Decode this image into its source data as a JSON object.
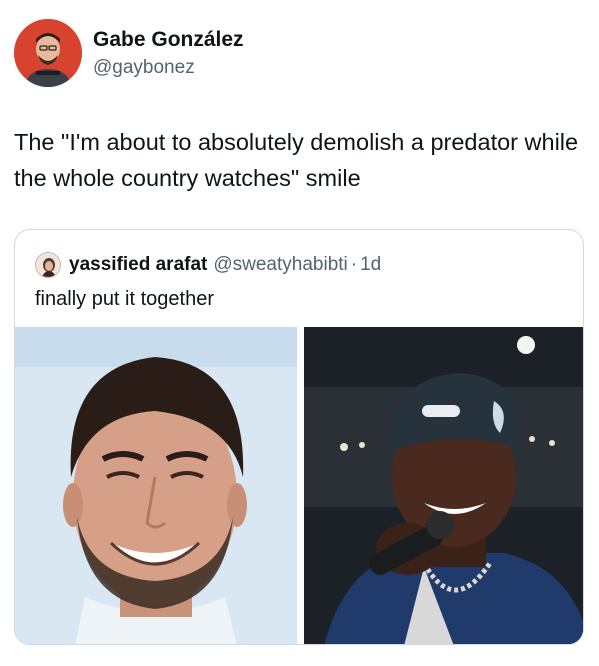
{
  "author": {
    "name": "Gabe González",
    "handle": "@gaybonez"
  },
  "tweet": {
    "text": "The \"I'm about to absolutely demolish a predator while the whole country watches\" smile"
  },
  "quoted_tweet": {
    "name": "yassified arafat",
    "handle": "@sweatyhabibti",
    "separator": "·",
    "time": "1d",
    "text": "finally put it together"
  },
  "colors": {
    "text_primary": "#0f1419",
    "text_secondary": "#536471",
    "border": "#cfd9de",
    "avatar_bg": "#d8432f"
  },
  "icons": {
    "author_avatar": "person-avatar-icon",
    "quote_avatar": "person-avatar-icon"
  }
}
